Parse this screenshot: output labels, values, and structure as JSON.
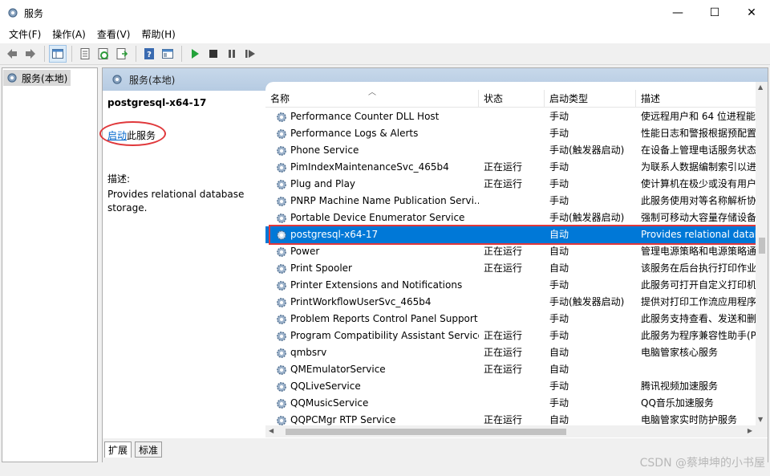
{
  "window": {
    "title": "服务",
    "minimize": "—",
    "maximize": "☐",
    "close": "✕"
  },
  "menu": [
    "文件(F)",
    "操作(A)",
    "查看(V)",
    "帮助(H)"
  ],
  "tree": {
    "item": "服务(本地)"
  },
  "content": {
    "header": "服务(本地)",
    "selected_service": "postgresql-x64-17",
    "start_link": "启动",
    "start_suffix": "此服务",
    "desc_label": "描述:",
    "desc_text": "Provides relational database storage."
  },
  "columns": {
    "name": "名称",
    "status": "状态",
    "start_type": "启动类型",
    "desc": "描述"
  },
  "rows": [
    {
      "name": "Performance Counter DLL Host",
      "status": "",
      "start_type": "手动",
      "desc": "使远程用户和 64 位进程能"
    },
    {
      "name": "Performance Logs & Alerts",
      "status": "",
      "start_type": "手动",
      "desc": "性能日志和警报根据预配置"
    },
    {
      "name": "Phone Service",
      "status": "",
      "start_type": "手动(触发器启动)",
      "desc": "在设备上管理电话服务状态"
    },
    {
      "name": "PimIndexMaintenanceSvc_465b4",
      "status": "正在运行",
      "start_type": "手动",
      "desc": "为联系人数据编制索引以进"
    },
    {
      "name": "Plug and Play",
      "status": "正在运行",
      "start_type": "手动",
      "desc": "使计算机在极少或没有用户"
    },
    {
      "name": "PNRP Machine Name Publication Servi...",
      "status": "",
      "start_type": "手动",
      "desc": "此服务使用对等名称解析协"
    },
    {
      "name": "Portable Device Enumerator Service",
      "status": "",
      "start_type": "手动(触发器启动)",
      "desc": "强制可移动大容量存储设备"
    },
    {
      "name": "postgresql-x64-17",
      "status": "",
      "start_type": "自动",
      "desc": "Provides relational datab",
      "selected": true
    },
    {
      "name": "Power",
      "status": "正在运行",
      "start_type": "自动",
      "desc": "管理电源策略和电源策略通"
    },
    {
      "name": "Print Spooler",
      "status": "正在运行",
      "start_type": "自动",
      "desc": "该服务在后台执行打印作业"
    },
    {
      "name": "Printer Extensions and Notifications",
      "status": "",
      "start_type": "手动",
      "desc": "此服务可打开自定义打印机"
    },
    {
      "name": "PrintWorkflowUserSvc_465b4",
      "status": "",
      "start_type": "手动(触发器启动)",
      "desc": "提供对打印工作流应用程序"
    },
    {
      "name": "Problem Reports Control Panel Support",
      "status": "",
      "start_type": "手动",
      "desc": "此服务支持查看、发送和删"
    },
    {
      "name": "Program Compatibility Assistant Service",
      "status": "正在运行",
      "start_type": "手动",
      "desc": "此服务为程序兼容性助手(P"
    },
    {
      "name": "qmbsrv",
      "status": "正在运行",
      "start_type": "自动",
      "desc": "电脑管家核心服务"
    },
    {
      "name": "QMEmulatorService",
      "status": "正在运行",
      "start_type": "自动",
      "desc": ""
    },
    {
      "name": "QQLiveService",
      "status": "",
      "start_type": "手动",
      "desc": "腾讯视频加速服务"
    },
    {
      "name": "QQMusicService",
      "status": "",
      "start_type": "手动",
      "desc": "QQ音乐加速服务"
    },
    {
      "name": "QQPCMgr RTP Service",
      "status": "正在运行",
      "start_type": "自动",
      "desc": "电脑管家实时防护服务"
    }
  ],
  "tabs": [
    "扩展",
    "标准"
  ],
  "watermark": "CSDN @蔡坤坤的小书屋",
  "colors": {
    "selection": "#0078d7",
    "annotation": "#e0383b",
    "link": "#0066cc"
  }
}
